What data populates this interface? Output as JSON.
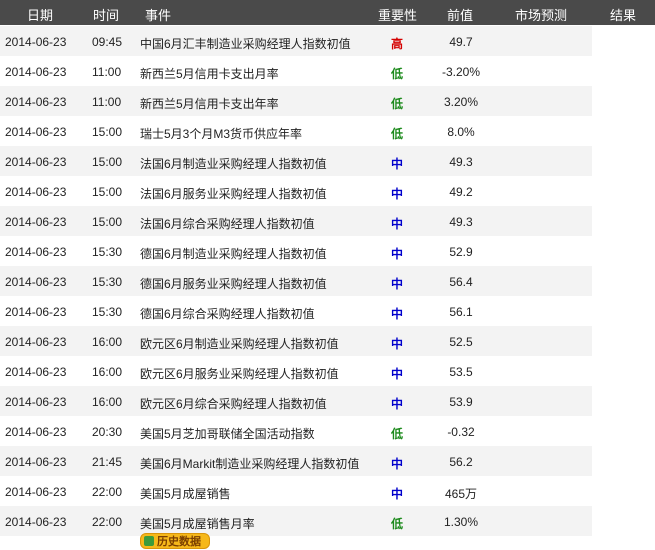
{
  "header": {
    "date": "日期",
    "time": "时间",
    "event": "事件",
    "importance": "重要性",
    "previous": "前值",
    "forecast": "市场预测",
    "result": "结果"
  },
  "rows": [
    {
      "date": "2014-06-23",
      "time": "09:45",
      "event": "中国6月汇丰制造业采购经理人指数初值",
      "importance": "高",
      "level": "high",
      "previous": "49.7"
    },
    {
      "date": "2014-06-23",
      "time": "11:00",
      "event": "新西兰5月信用卡支出月率",
      "importance": "低",
      "level": "low",
      "previous": "-3.20%"
    },
    {
      "date": "2014-06-23",
      "time": "11:00",
      "event": "新西兰5月信用卡支出年率",
      "importance": "低",
      "level": "low",
      "previous": "3.20%"
    },
    {
      "date": "2014-06-23",
      "time": "15:00",
      "event": "瑞士5月3个月M3货币供应年率",
      "importance": "低",
      "level": "low",
      "previous": "8.0%"
    },
    {
      "date": "2014-06-23",
      "time": "15:00",
      "event": "法国6月制造业采购经理人指数初值",
      "importance": "中",
      "level": "mid",
      "previous": "49.3"
    },
    {
      "date": "2014-06-23",
      "time": "15:00",
      "event": "法国6月服务业采购经理人指数初值",
      "importance": "中",
      "level": "mid",
      "previous": "49.2"
    },
    {
      "date": "2014-06-23",
      "time": "15:00",
      "event": "法国6月综合采购经理人指数初值",
      "importance": "中",
      "level": "mid",
      "previous": "49.3"
    },
    {
      "date": "2014-06-23",
      "time": "15:30",
      "event": "德国6月制造业采购经理人指数初值",
      "importance": "中",
      "level": "mid",
      "previous": "52.9"
    },
    {
      "date": "2014-06-23",
      "time": "15:30",
      "event": "德国6月服务业采购经理人指数初值",
      "importance": "中",
      "level": "mid",
      "previous": "56.4"
    },
    {
      "date": "2014-06-23",
      "time": "15:30",
      "event": "德国6月综合采购经理人指数初值",
      "importance": "中",
      "level": "mid",
      "previous": "56.1"
    },
    {
      "date": "2014-06-23",
      "time": "16:00",
      "event": "欧元区6月制造业采购经理人指数初值",
      "importance": "中",
      "level": "mid",
      "previous": "52.5"
    },
    {
      "date": "2014-06-23",
      "time": "16:00",
      "event": "欧元区6月服务业采购经理人指数初值",
      "importance": "中",
      "level": "mid",
      "previous": "53.5"
    },
    {
      "date": "2014-06-23",
      "time": "16:00",
      "event": "欧元区6月综合采购经理人指数初值",
      "importance": "中",
      "level": "mid",
      "previous": "53.9"
    },
    {
      "date": "2014-06-23",
      "time": "20:30",
      "event": "美国5月芝加哥联储全国活动指数",
      "importance": "低",
      "level": "low",
      "previous": "-0.32"
    },
    {
      "date": "2014-06-23",
      "time": "21:45",
      "event": "美国6月Markit制造业采购经理人指数初值",
      "importance": "中",
      "level": "mid",
      "previous": "56.2"
    },
    {
      "date": "2014-06-23",
      "time": "22:00",
      "event": "美国5月成屋销售",
      "importance": "中",
      "level": "mid",
      "previous": "465万"
    },
    {
      "date": "2014-06-23",
      "time": "22:00",
      "event": "美国5月成屋销售月率",
      "importance": "低",
      "level": "low",
      "previous": "1.30%"
    }
  ],
  "history_button": {
    "label": "历史数据",
    "icon": "chart-icon"
  },
  "colors": {
    "high": "#d40000",
    "mid": "#0000cc",
    "low": "#1c8a1c",
    "header_bg": "#4a4a4a",
    "row_alt": "#f3f3f3"
  }
}
